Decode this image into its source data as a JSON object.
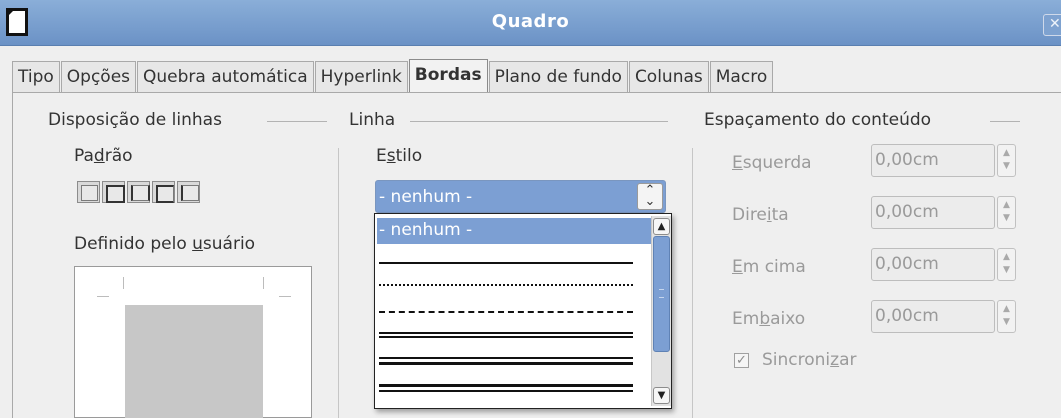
{
  "window": {
    "title": "Quadro"
  },
  "tabs": [
    {
      "label": "Tipo",
      "active": false
    },
    {
      "label": "Opções",
      "active": false
    },
    {
      "label": "Quebra automática",
      "active": false
    },
    {
      "label": "Hyperlink",
      "active": false
    },
    {
      "label": "Bordas",
      "active": true
    },
    {
      "label": "Plano de fundo",
      "active": false
    },
    {
      "label": "Colunas",
      "active": false
    },
    {
      "label": "Macro",
      "active": false
    }
  ],
  "line_arrangement": {
    "title": "Disposição de linhas",
    "default_label": {
      "before": "Pa",
      "mnemonic": "d",
      "after": "rão"
    },
    "user_defined_label": {
      "before": "Definido pelo ",
      "mnemonic": "u",
      "after": "suário"
    }
  },
  "line": {
    "title": "Linha",
    "style_label": {
      "before": "E",
      "mnemonic": "s",
      "after": "tilo"
    },
    "style_value": "- nenhum -",
    "options": [
      {
        "label": "- nenhum -",
        "selected": true
      },
      {
        "label": "",
        "kind": "solid"
      },
      {
        "label": "",
        "kind": "dotted"
      },
      {
        "label": "",
        "kind": "dashed"
      },
      {
        "label": "",
        "kind": "double"
      },
      {
        "label": "",
        "kind": "double-thin-thick"
      },
      {
        "label": "",
        "kind": "double-thick-thin"
      }
    ]
  },
  "spacing": {
    "title": "Espaçamento do conteúdo",
    "fields": [
      {
        "label": {
          "before": "",
          "mnemonic": "E",
          "after": "squerda"
        },
        "value": "0,00cm"
      },
      {
        "label": {
          "before": "Dire",
          "mnemonic": "i",
          "after": "ta"
        },
        "value": "0,00cm"
      },
      {
        "label": {
          "before": "",
          "mnemonic": "E",
          "after": "m cima"
        },
        "value": "0,00cm"
      },
      {
        "label": {
          "before": "Em",
          "mnemonic": "b",
          "after": "aixo"
        },
        "value": "0,00cm"
      }
    ],
    "synchronize": {
      "label": {
        "before": "Sincroni",
        "mnemonic": "z",
        "after": "ar"
      },
      "checked": true
    }
  },
  "icons": {
    "app": "document-icon",
    "close": "close-icon",
    "check": "☑"
  }
}
